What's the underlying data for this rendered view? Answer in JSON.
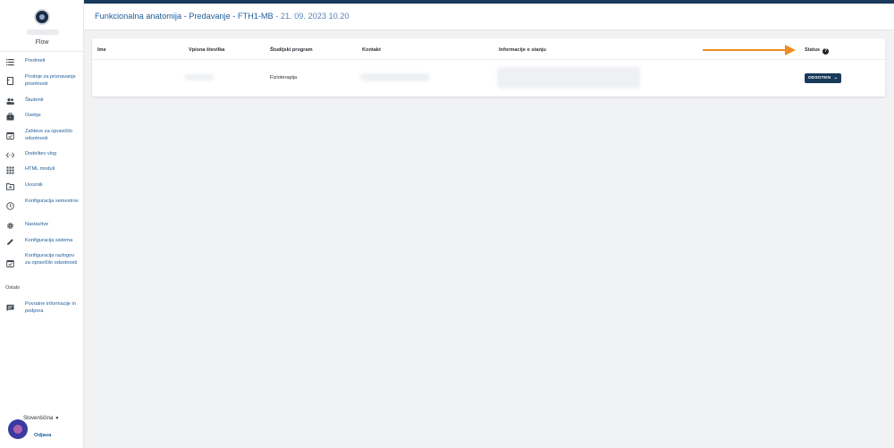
{
  "app": {
    "name": "Flow"
  },
  "header": {
    "title": "Funkcionalna anatomija - Predavanje - FTH1-MB",
    "datetime": " - 21. 09. 2023 10.20"
  },
  "sidebar": {
    "items": [
      {
        "label": "Predmeti",
        "icon": "list-icon"
      },
      {
        "label": "Prošnje za priznavanje prisotnosti",
        "icon": "document-icon"
      },
      {
        "label": "Študenti",
        "icon": "people-icon"
      },
      {
        "label": "Osebje",
        "icon": "briefcase-icon"
      },
      {
        "label": "Zahteve za opravičilo odsotnosti",
        "icon": "calendar-check-icon"
      },
      {
        "label": "Dodelitev vlog",
        "icon": "code-icon"
      },
      {
        "label": "HTML moduli",
        "icon": "grid-icon"
      },
      {
        "label": "Uvoznik",
        "icon": "folder-import-icon"
      },
      {
        "label": "Konfiguracija semestrov",
        "icon": "clock-icon"
      },
      {
        "label": "Nastavitve",
        "icon": "gear-icon"
      },
      {
        "label": "Konfiguracija sistema",
        "icon": "pencil-icon"
      },
      {
        "label": "Konfiguracija razlogov za opravičilo odsotnosti",
        "icon": "calendar-check-icon"
      }
    ],
    "section_other": "Ostalo",
    "other_items": [
      {
        "label": "Povratne informacije in podpora",
        "icon": "feedback-icon"
      }
    ],
    "language": "Slovenščina",
    "logout": "Odjava"
  },
  "table": {
    "columns": [
      "Ime",
      "Vpisna številka",
      "Študijski program",
      "Kontakt",
      "Informacije o stanju",
      "Status"
    ],
    "rows": [
      {
        "program": "Fizioterapija",
        "status": "ODSOTEN"
      }
    ]
  },
  "colors": {
    "accent": "#1a3a5c",
    "link": "#1e5c97",
    "arrow": "#f08a24"
  }
}
